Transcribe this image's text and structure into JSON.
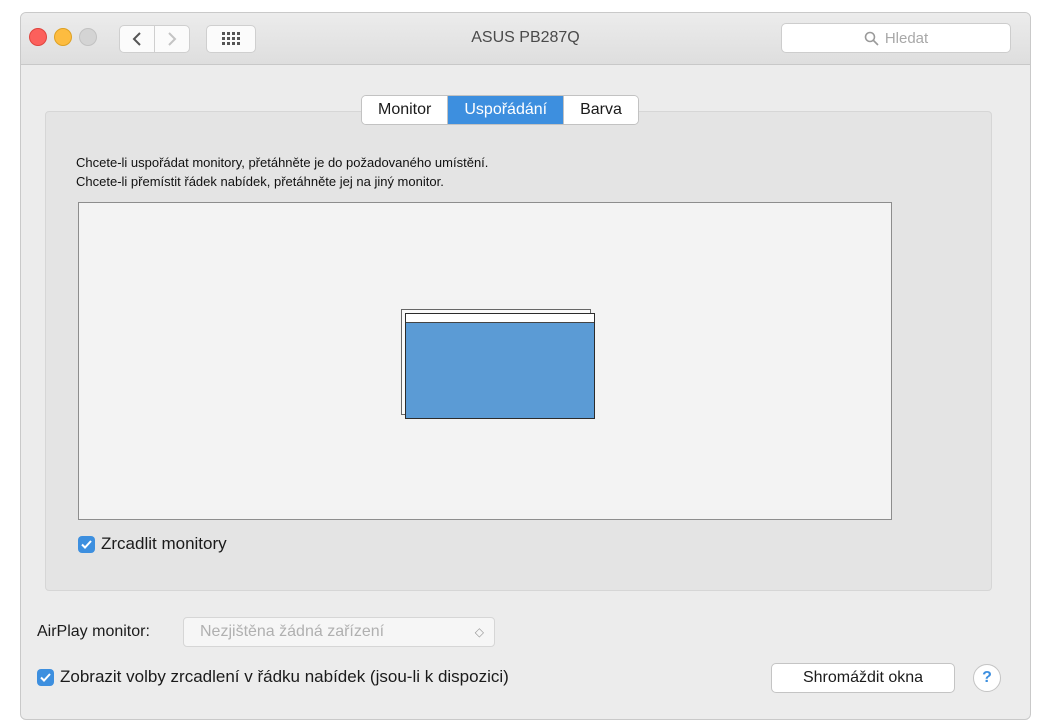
{
  "window": {
    "title": "ASUS PB287Q",
    "search_placeholder": "Hledat"
  },
  "icons": {
    "close": "close-icon",
    "minimize": "minimize-icon",
    "zoom": "zoom-icon",
    "back": "chevron-left-icon",
    "forward": "chevron-right-icon",
    "show_all": "grid-icon",
    "search": "search-icon",
    "checkmark": "checkmark-icon",
    "popup": "updown-icon"
  },
  "tabs": [
    {
      "label": "Monitor",
      "active": false
    },
    {
      "label": "Uspořádání",
      "active": true
    },
    {
      "label": "Barva",
      "active": false
    }
  ],
  "arrangement": {
    "instruction_1": "Chcete-li uspořádat monitory, přetáhněte je do požadovaného umístění.",
    "instruction_2": "Chcete-li přemístit řádek nabídek, přetáhněte jej na jiný monitor.",
    "mirror_label": "Zrcadlit monitory",
    "mirror_checked": true
  },
  "airplay": {
    "label": "AirPlay monitor:",
    "value": "Nezjištěna žádná zařízení"
  },
  "menubar_option": {
    "label": "Zobrazit volby zrcadlení v řádku nabídek (jsou-li k dispozici)",
    "checked": true
  },
  "buttons": {
    "gather": "Shromáždit okna",
    "help": "?"
  },
  "colors": {
    "accent": "#3d8fdf",
    "monitor_fill": "#5b9bd5",
    "close": "#fc605c",
    "minimize": "#fdbc40",
    "zoom_inactive": "#d4d4d4"
  }
}
